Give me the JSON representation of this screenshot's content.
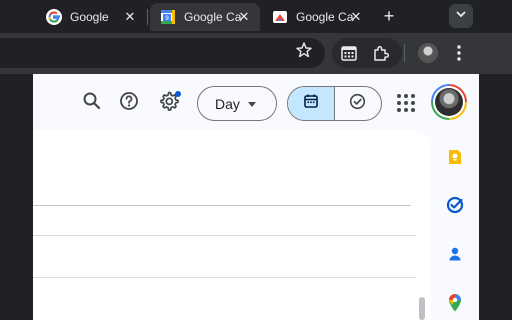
{
  "tabs": [
    {
      "title": "Google",
      "icon": "google-g-icon",
      "active": false,
      "close": "✕"
    },
    {
      "title": "Google Ca",
      "icon": "google-calendar-icon",
      "active": true,
      "close": "✕"
    },
    {
      "title": "Google Ca",
      "icon": "google-slides-icon",
      "active": false,
      "close": "✕"
    }
  ],
  "new_tab_label": "+",
  "calendar": {
    "view_label": "Day",
    "favicon_text": "9"
  },
  "colors": {
    "accent": "#0b57d0",
    "selected_segment": "#c2e7ff",
    "chrome_dark": "#202124",
    "toolbar": "#35363a"
  }
}
